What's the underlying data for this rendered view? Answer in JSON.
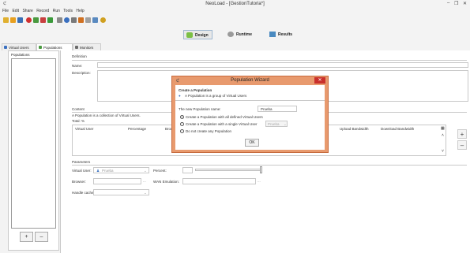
{
  "window": {
    "title": "NeoLoad - [GestionTutoria*]",
    "minimize": "–",
    "maximize": "❐",
    "close": "✕"
  },
  "menu": [
    "File",
    "Edit",
    "Share",
    "Record",
    "Run",
    "Tools",
    "Help"
  ],
  "modes": {
    "design": "Design",
    "runtime": "Runtime",
    "results": "Results"
  },
  "tabs": {
    "virtual_users": "Virtual Users",
    "populations": "Populations",
    "monitors": "Monitors"
  },
  "left_panel": {
    "title": "Populations",
    "add": "+",
    "remove": "–"
  },
  "definition": {
    "section": "Definition",
    "name_label": "Name:",
    "description_label": "Description:"
  },
  "content": {
    "section": "Content",
    "subtitle": "A Population is a collection of Virtual Users.",
    "total": "Total: %",
    "columns": [
      "Virtual User",
      "Percentage",
      "Browser",
      "Upload Bandwidth",
      "Download Bandwidth"
    ],
    "add_row": "+",
    "remove_row": "–"
  },
  "parameters": {
    "section": "Parameters",
    "virtual_user_label": "Virtual User:",
    "virtual_user_value": "Prueba",
    "percent_label": "Percent:",
    "browser_label": "Browser:",
    "wan_label": "WAN Emulation:",
    "handle_cache_label": "Handle cache:"
  },
  "dialog": {
    "title": "Population Wizard",
    "close": "✕",
    "heading": "Create a Population",
    "info": "A Population is a group of Virtual Users",
    "name_label": "The new Population name:",
    "name_value": "Prueba",
    "opt_all": "Create a Population with all defined Virtual Users",
    "opt_single": "Create a Population with a single Virtual User",
    "opt_single_value": "Prueba",
    "opt_none": "Do not create any Population",
    "ok": "OK",
    "selected": "opt_all"
  },
  "colors": {
    "dialog_frame": "#e89a6e",
    "close_red": "#c9302c",
    "design_highlight": "#9fb7d0"
  }
}
